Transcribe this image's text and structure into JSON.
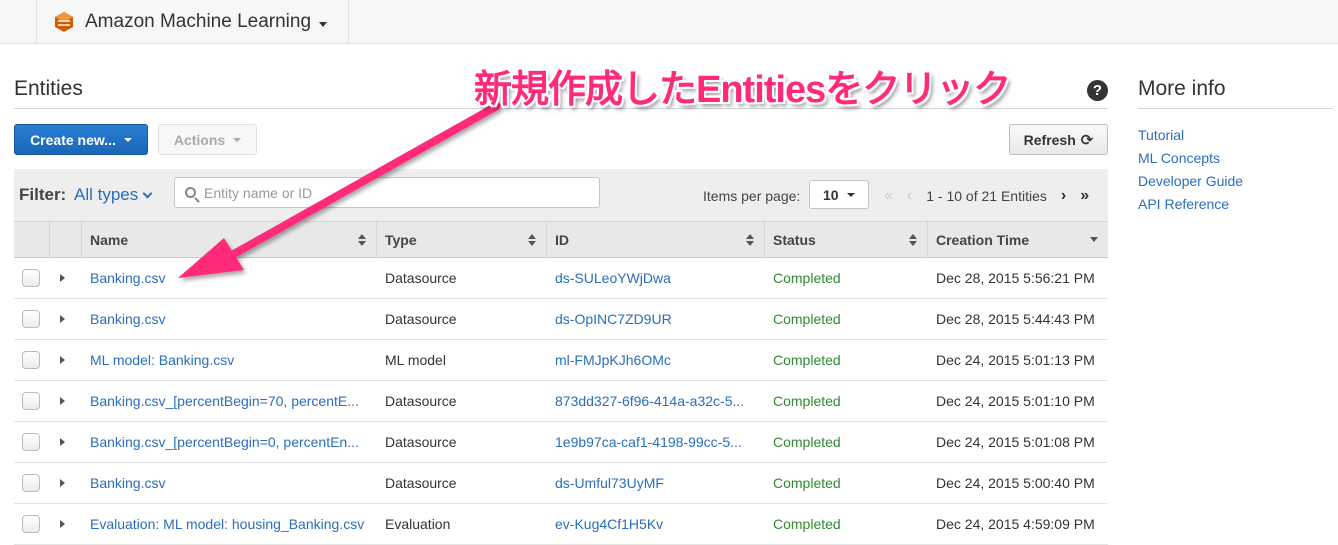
{
  "topbar": {
    "service_name": "Amazon Machine Learning"
  },
  "page": {
    "title": "Entities"
  },
  "toolbar": {
    "create_label": "Create new...",
    "actions_label": "Actions",
    "refresh_label": "Refresh"
  },
  "filter": {
    "label": "Filter:",
    "value": "All types",
    "search_placeholder": "Entity name or ID",
    "items_per_page_label": "Items per page:",
    "items_per_page": "10",
    "page_range": "1 - 10 of 21 Entities"
  },
  "table": {
    "headers": {
      "name": "Name",
      "type": "Type",
      "id": "ID",
      "status": "Status",
      "time": "Creation Time"
    },
    "rows": [
      {
        "name": "Banking.csv",
        "type": "Datasource",
        "id": "ds-SULeoYWjDwa",
        "status": "Completed",
        "time": "Dec 28, 2015 5:56:21 PM"
      },
      {
        "name": "Banking.csv",
        "type": "Datasource",
        "id": "ds-OpINC7ZD9UR",
        "status": "Completed",
        "time": "Dec 28, 2015 5:44:43 PM"
      },
      {
        "name": "ML model: Banking.csv",
        "type": "ML model",
        "id": "ml-FMJpKJh6OMc",
        "status": "Completed",
        "time": "Dec 24, 2015 5:01:13 PM"
      },
      {
        "name": "Banking.csv_[percentBegin=70, percentE...",
        "type": "Datasource",
        "id": "873dd327-6f96-414a-a32c-5...",
        "status": "Completed",
        "time": "Dec 24, 2015 5:01:10 PM"
      },
      {
        "name": "Banking.csv_[percentBegin=0, percentEn...",
        "type": "Datasource",
        "id": "1e9b97ca-caf1-4198-99cc-5...",
        "status": "Completed",
        "time": "Dec 24, 2015 5:01:08 PM"
      },
      {
        "name": "Banking.csv",
        "type": "Datasource",
        "id": "ds-Umful73UyMF",
        "status": "Completed",
        "time": "Dec 24, 2015 5:00:40 PM"
      },
      {
        "name": "Evaluation: ML model: housing_Banking.csv",
        "type": "Evaluation",
        "id": "ev-Kug4Cf1H5Kv",
        "status": "Completed",
        "time": "Dec 24, 2015 4:59:09 PM"
      }
    ]
  },
  "more_info": {
    "title": "More info",
    "links": [
      "Tutorial",
      "ML Concepts",
      "Developer Guide",
      "API Reference"
    ]
  },
  "annotation": {
    "text": "新規作成したEntitiesをクリック"
  },
  "colors": {
    "primary": "#1a66b8",
    "link": "#2a6ebd",
    "success": "#2e8b2e",
    "annotation": "#ff2b7a"
  },
  "icons": {
    "logo": "aws-ml-logo-icon",
    "help": "help-icon",
    "search": "search-icon",
    "refresh": "refresh-icon"
  }
}
